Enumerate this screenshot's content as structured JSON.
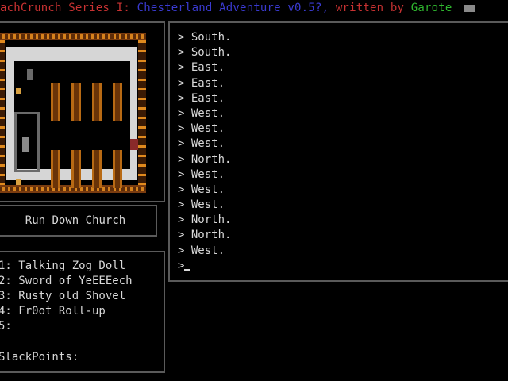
{
  "title": {
    "game": "achCrunch Series I:",
    "episode": "Chesterland Adventure v0.5?,",
    "by": "written by",
    "author": "Garote"
  },
  "colors": {
    "title_red": "#c83232",
    "title_blue": "#3a3ad0",
    "author_green": "#2fb82f",
    "wall_orange": "#e08a1e",
    "floor_gray": "#d6d6d6"
  },
  "location": {
    "name": "Run Down Church"
  },
  "inventory": {
    "items": [
      "1: Talking Zog Doll",
      "2: Sword of YeEEEech",
      "3: Rusty old Shovel",
      "4: Fr0ot Roll-up",
      "5:"
    ],
    "slackpoints_label": "SlackPoints:"
  },
  "log": {
    "lines": [
      "> South.",
      "> South.",
      "> East.",
      "> East.",
      "> East.",
      "> West.",
      "> West.",
      "> West.",
      "> North.",
      "> West.",
      "> West.",
      "> West.",
      "> North.",
      "> North.",
      "> West."
    ],
    "prompt": ">"
  }
}
